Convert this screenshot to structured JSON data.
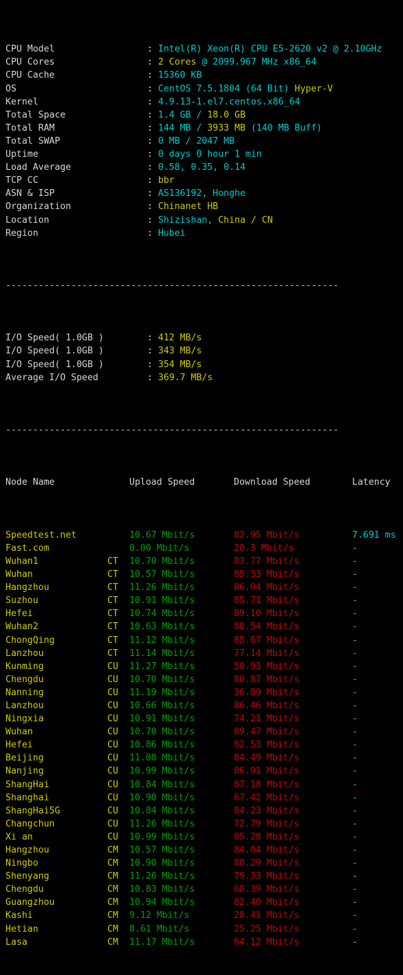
{
  "terminal": {
    "separator": "-------------------------------------------------------------",
    "colors": {
      "background": "#000000",
      "text": "#d8d8d8",
      "cyan": "#00cdcd",
      "yellow": "#cdcd00",
      "green": "#00a000",
      "red": "#cd0000"
    }
  },
  "sysinfo": [
    {
      "label": "CPU Model",
      "value_cyan": "Intel(R) Xeon(R) CPU E5-2620 v2 @ 2.10GHz",
      "value_yellow": ""
    },
    {
      "label": "CPU Cores",
      "value_cyan": "",
      "value_yellow": "2 Cores",
      "value_cyan2": " @ 2099.967 MHz x86_64"
    },
    {
      "label": "CPU Cache",
      "value_cyan": "15360 KB",
      "value_yellow": ""
    },
    {
      "label": "OS",
      "value_cyan": "CentOS 7.5.1804 (64 Bit) ",
      "value_yellow": "Hyper-V"
    },
    {
      "label": "Kernel",
      "value_cyan": "4.9.13-1.el7.centos.x86_64",
      "value_yellow": ""
    },
    {
      "label": "Total Space",
      "value_cyan": "1.4 GB / ",
      "value_yellow": "18.0 GB"
    },
    {
      "label": "Total RAM",
      "value_cyan": "144 MB / ",
      "value_yellow": "3933 MB",
      "value_cyan2": " (140 MB Buff)"
    },
    {
      "label": "Total SWAP",
      "value_cyan": "0 MB / 2047 MB",
      "value_yellow": ""
    },
    {
      "label": "Uptime",
      "value_cyan": "0 days 0 hour 1 min",
      "value_yellow": ""
    },
    {
      "label": "Load Average",
      "value_cyan": "0.58, 0.35, 0.14",
      "value_yellow": ""
    },
    {
      "label": "TCP CC",
      "value_cyan": "",
      "value_yellow": "bbr"
    },
    {
      "label": "ASN & ISP",
      "value_cyan": "AS136192, Honghe",
      "value_yellow": ""
    },
    {
      "label": "Organization",
      "value_cyan": "",
      "value_yellow": "Chinanet HB"
    },
    {
      "label": "Location",
      "value_cyan": "Shizishan, ",
      "value_yellow": "China / CN"
    },
    {
      "label": "Region",
      "value_cyan": "Hubei",
      "value_yellow": ""
    }
  ],
  "iospeed": [
    {
      "label": "I/O Speed( 1.0GB )",
      "value": "412 MB/s"
    },
    {
      "label": "I/O Speed( 1.0GB )",
      "value": "343 MB/s"
    },
    {
      "label": "I/O Speed( 1.0GB )",
      "value": "354 MB/s"
    },
    {
      "label": "Average I/O Speed",
      "value": "369.7 MB/s"
    }
  ],
  "speedtest": {
    "headers": {
      "node": "Node Name",
      "upload": "Upload Speed",
      "download": "Download Speed",
      "latency": "Latency"
    },
    "rows": [
      {
        "node": "Speedtest.net",
        "isp": "",
        "upload": "10.67 Mbit/s",
        "download": "82.95 Mbit/s",
        "latency": "7.691 ms"
      },
      {
        "node": "Fast.com",
        "isp": "",
        "upload": "0.00 Mbit/s",
        "download": "20.3 Mbit/s",
        "latency": "-"
      },
      {
        "node": "Wuhan1",
        "isp": "CT",
        "upload": "10.70 Mbit/s",
        "download": "83.77 Mbit/s",
        "latency": "-"
      },
      {
        "node": "Wuhan",
        "isp": "CT",
        "upload": "10.57 Mbit/s",
        "download": "85.33 Mbit/s",
        "latency": "-"
      },
      {
        "node": "Hangzhou",
        "isp": "CT",
        "upload": "11.26 Mbit/s",
        "download": "86.04 Mbit/s",
        "latency": "-"
      },
      {
        "node": "Suzhou",
        "isp": "CT",
        "upload": "10.91 Mbit/s",
        "download": "85.71 Mbit/s",
        "latency": "-"
      },
      {
        "node": "Hefei",
        "isp": "CT",
        "upload": "10.74 Mbit/s",
        "download": "89.10 Mbit/s",
        "latency": "-"
      },
      {
        "node": "Wuhan2",
        "isp": "CT",
        "upload": "10.63 Mbit/s",
        "download": "88.54 Mbit/s",
        "latency": "-"
      },
      {
        "node": "ChongQing",
        "isp": "CT",
        "upload": "11.12 Mbit/s",
        "download": "85.67 Mbit/s",
        "latency": "-"
      },
      {
        "node": "Lanzhou",
        "isp": "CT",
        "upload": "11.14 Mbit/s",
        "download": "77.14 Mbit/s",
        "latency": "-"
      },
      {
        "node": "Kunming",
        "isp": "CU",
        "upload": "11.27 Mbit/s",
        "download": "50.93 Mbit/s",
        "latency": "-"
      },
      {
        "node": "Chengdu",
        "isp": "CU",
        "upload": "10.70 Mbit/s",
        "download": "80.87 Mbit/s",
        "latency": "-"
      },
      {
        "node": "Nanning",
        "isp": "CU",
        "upload": "11.19 Mbit/s",
        "download": "36.89 Mbit/s",
        "latency": "-"
      },
      {
        "node": "Lanzhou",
        "isp": "CU",
        "upload": "10.66 Mbit/s",
        "download": "86.46 Mbit/s",
        "latency": "-"
      },
      {
        "node": "Ningxia",
        "isp": "CU",
        "upload": "10.91 Mbit/s",
        "download": "74.21 Mbit/s",
        "latency": "-"
      },
      {
        "node": "Wuhan",
        "isp": "CU",
        "upload": "10.70 Mbit/s",
        "download": "89.47 Mbit/s",
        "latency": "-"
      },
      {
        "node": "Hefei",
        "isp": "CU",
        "upload": "10.86 Mbit/s",
        "download": "82.53 Mbit/s",
        "latency": "-"
      },
      {
        "node": "Beijing",
        "isp": "CU",
        "upload": "11.08 Mbit/s",
        "download": "84.49 Mbit/s",
        "latency": "-"
      },
      {
        "node": "Nanjing",
        "isp": "CU",
        "upload": "10.99 Mbit/s",
        "download": "86.91 Mbit/s",
        "latency": "-"
      },
      {
        "node": "ShangHai",
        "isp": "CU",
        "upload": "10.84 Mbit/s",
        "download": "87.18 Mbit/s",
        "latency": "-"
      },
      {
        "node": "Shanghai",
        "isp": "CU",
        "upload": "10.90 Mbit/s",
        "download": "67.42 Mbit/s",
        "latency": "-"
      },
      {
        "node": "ShangHai5G",
        "isp": "CU",
        "upload": "10.84 Mbit/s",
        "download": "84.23 Mbit/s",
        "latency": "-"
      },
      {
        "node": "Changchun",
        "isp": "CU",
        "upload": "11.26 Mbit/s",
        "download": "72.79 Mbit/s",
        "latency": "-"
      },
      {
        "node": "Xi an",
        "isp": "CU",
        "upload": "10.99 Mbit/s",
        "download": "85.28 Mbit/s",
        "latency": "-"
      },
      {
        "node": "Hangzhou",
        "isp": "CM",
        "upload": "10.57 Mbit/s",
        "download": "84.04 Mbit/s",
        "latency": "-"
      },
      {
        "node": "Ningbo",
        "isp": "CM",
        "upload": "10.90 Mbit/s",
        "download": "88.29 Mbit/s",
        "latency": "-"
      },
      {
        "node": "Shenyang",
        "isp": "CM",
        "upload": "11.26 Mbit/s",
        "download": "79.33 Mbit/s",
        "latency": "-"
      },
      {
        "node": "Chengdu",
        "isp": "CM",
        "upload": "10.83 Mbit/s",
        "download": "68.39 Mbit/s",
        "latency": "-"
      },
      {
        "node": "Guangzhou",
        "isp": "CM",
        "upload": "10.94 Mbit/s",
        "download": "82.40 Mbit/s",
        "latency": "-"
      },
      {
        "node": "Kashi",
        "isp": "CM",
        "upload": "9.12 Mbit/s",
        "download": "28.41 Mbit/s",
        "latency": "-"
      },
      {
        "node": "Hetian",
        "isp": "CM",
        "upload": "8.61 Mbit/s",
        "download": "25.25 Mbit/s",
        "latency": "-"
      },
      {
        "node": "Lasa",
        "isp": "CM",
        "upload": "11.17 Mbit/s",
        "download": "64.12 Mbit/s",
        "latency": "-"
      }
    ]
  }
}
